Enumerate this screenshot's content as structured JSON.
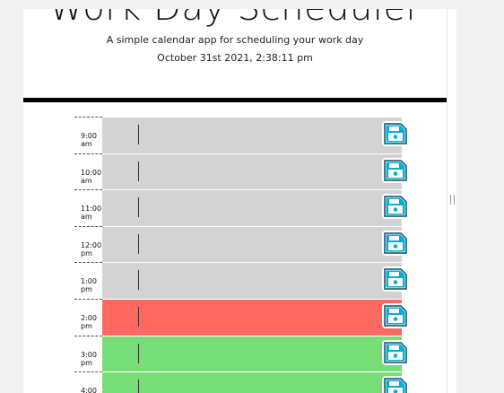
{
  "header": {
    "title": "Work Day Scheduler",
    "subtitle": "A simple calendar app for scheduling your work day",
    "current_datetime": "October 31st 2021, 2:38:11 pm"
  },
  "rows": [
    {
      "hour_line1": "9:00",
      "hour_line2": "am",
      "status": "past",
      "event": ""
    },
    {
      "hour_line1": "10:00",
      "hour_line2": "am",
      "status": "past",
      "event": ""
    },
    {
      "hour_line1": "11:00",
      "hour_line2": "am",
      "status": "past",
      "event": ""
    },
    {
      "hour_line1": "12:00",
      "hour_line2": "pm",
      "status": "past",
      "event": ""
    },
    {
      "hour_line1": "1:00",
      "hour_line2": "pm",
      "status": "past",
      "event": ""
    },
    {
      "hour_line1": "2:00",
      "hour_line2": "pm",
      "status": "present",
      "event": ""
    },
    {
      "hour_line1": "3:00",
      "hour_line2": "pm",
      "status": "future",
      "event": ""
    },
    {
      "hour_line1": "4:00",
      "hour_line2": "pm",
      "status": "future",
      "event": ""
    }
  ],
  "colors": {
    "past": "#d3d3d3",
    "present": "#ff6961",
    "future": "#77dd77",
    "save_icon": "#06aed5"
  },
  "icons": {
    "save": "floppy-disk-icon"
  }
}
